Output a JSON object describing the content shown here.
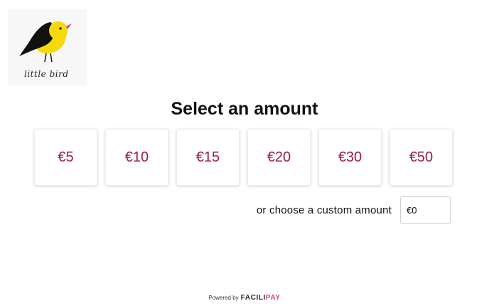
{
  "logo": {
    "name": "little bird",
    "icon": "bird-icon"
  },
  "title": "Select an amount",
  "amounts": [
    "€5",
    "€10",
    "€15",
    "€20",
    "€30",
    "€50"
  ],
  "custom": {
    "label": "or choose a custom amount",
    "value": "€0"
  },
  "footer": {
    "powered_by": "Powered by",
    "brand_main": "FACILI",
    "brand_accent": "PAY"
  },
  "colors": {
    "amount_text": "#9a1b4c",
    "bird_yellow": "#f5d90a",
    "brand_accent": "#e0407a"
  }
}
